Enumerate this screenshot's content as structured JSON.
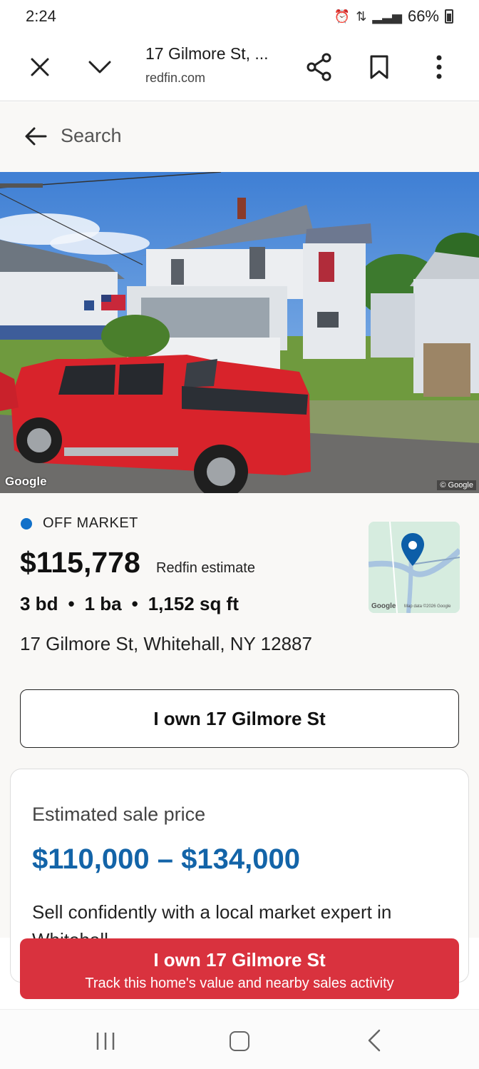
{
  "status_bar": {
    "time": "2:24",
    "battery": "66%"
  },
  "browser": {
    "title": "17 Gilmore St, ...",
    "domain": "redfin.com"
  },
  "search": {
    "label": "Search"
  },
  "photo": {
    "watermark_left": "Google",
    "watermark_right": "© Google"
  },
  "listing": {
    "status": "OFF MARKET",
    "price": "$115,778",
    "price_note": "Redfin estimate",
    "beds": "3 bd",
    "baths": "1 ba",
    "sqft": "1,152 sq ft",
    "address": "17 Gilmore St, Whitehall, NY 12887",
    "map_watermark": "Google",
    "map_data": "Map data ©2026 Google",
    "own_button": "I own 17 Gilmore St"
  },
  "estimate_card": {
    "label": "Estimated sale price",
    "range": "$110,000 – $134,000",
    "text": "Sell confidently with a local market expert in",
    "text2": "Whitehall"
  },
  "cta": {
    "title": "I own 17 Gilmore St",
    "subtitle": "Track this home's value and nearby sales activity"
  },
  "colors": {
    "status_dot": "#1170c9",
    "range": "#1364a8",
    "cta": "#d9323e"
  }
}
